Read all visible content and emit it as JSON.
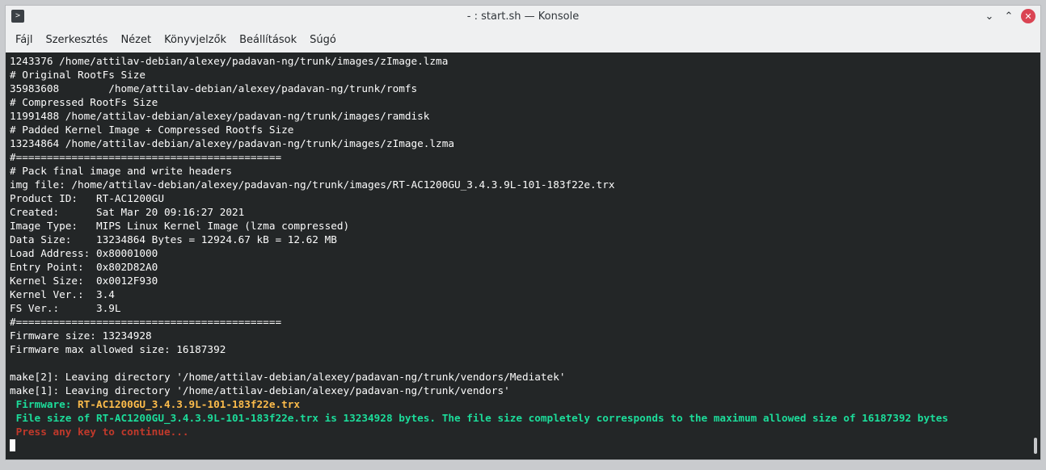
{
  "window": {
    "title": "- : start.sh — Konsole",
    "icon": "terminal-icon"
  },
  "menu": [
    "Fájl",
    "Szerkesztés",
    "Nézet",
    "Könyvjelzők",
    "Beállítások",
    "Súgó"
  ],
  "terminal": {
    "lines": [
      "1243376 /home/attilav-debian/alexey/padavan-ng/trunk/images/zImage.lzma",
      "# Original RootFs Size",
      "35983608        /home/attilav-debian/alexey/padavan-ng/trunk/romfs",
      "# Compressed RootFs Size",
      "11991488 /home/attilav-debian/alexey/padavan-ng/trunk/images/ramdisk",
      "# Padded Kernel Image + Compressed Rootfs Size",
      "13234864 /home/attilav-debian/alexey/padavan-ng/trunk/images/zImage.lzma",
      "#===========================================",
      "# Pack final image and write headers",
      "img file: /home/attilav-debian/alexey/padavan-ng/trunk/images/RT-AC1200GU_3.4.3.9L-101-183f22e.trx",
      "Product ID:   RT-AC1200GU",
      "Created:      Sat Mar 20 09:16:27 2021",
      "Image Type:   MIPS Linux Kernel Image (lzma compressed)",
      "Data Size:    13234864 Bytes = 12924.67 kB = 12.62 MB",
      "Load Address: 0x80001000",
      "Entry Point:  0x802D82A0",
      "Kernel Size:  0x0012F930",
      "Kernel Ver.:  3.4",
      "FS Ver.:      3.9L",
      "#===========================================",
      "Firmware size: 13234928",
      "Firmware max allowed size: 16187392",
      "",
      "make[2]: Leaving directory '/home/attilav-debian/alexey/padavan-ng/trunk/vendors/Mediatek'",
      "make[1]: Leaving directory '/home/attilav-debian/alexey/padavan-ng/trunk/vendors'"
    ],
    "firmware_label": " Firmware: ",
    "firmware_name": "RT-AC1200GU_3.4.3.9L-101-183f22e.trx",
    "size_message": " File size of RT-AC1200GU_3.4.3.9L-101-183f22e.trx is 13234928 bytes. The file size completely corresponds to the maximum allowed size of 16187392 bytes",
    "press_message": " Press any key to continue..."
  },
  "colors": {
    "terminal_bg": "#232627",
    "success_green": "#1cdc9a",
    "firmware_orange": "#fdbc4b",
    "prompt_red": "#c0392b",
    "close_red": "#da4453"
  }
}
